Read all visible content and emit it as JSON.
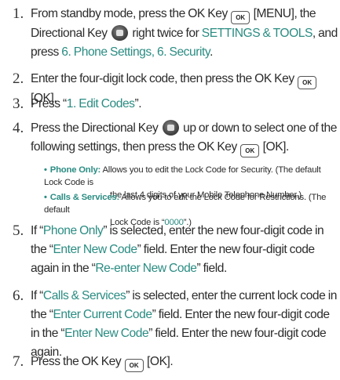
{
  "steps": [
    {
      "number": "1.",
      "t1": "From standby mode, press the OK Key",
      "t2": "[MENU], the Directional Key",
      "t3": "right twice for",
      "t4": "SETTINGS & TOOLS",
      "t5": ", and press",
      "t6": "6. Phone Settings, 6. Security",
      "t7": "."
    },
    {
      "number": "2.",
      "t1": "Enter the four-digit lock code, then press the OK Key",
      "t2": "[OK]."
    },
    {
      "number": "3.",
      "t1": "Press “",
      "t2": "1. Edit Codes",
      "t3": "”."
    },
    {
      "number": "4.",
      "t1": "Press the Directional Key",
      "t2": "up or down to select one of the following settings, then press the OK Key",
      "t3": "[OK]."
    },
    {
      "number": "5.",
      "t1": "If “",
      "t2": "Phone Only",
      "t3": "” is selected, enter the new four-digit code in the “",
      "t4": "Enter New Code",
      "t5": "” field. Enter the new four-digit code again in the “",
      "t6": "Re-enter New Code",
      "t7": "” field."
    },
    {
      "number": "6.",
      "t1": "If “",
      "t2": "Calls & Services",
      "t3": "” is selected, enter the current lock code in the “",
      "t4": "Enter Current Code",
      "t5": "” field. Enter the new four-digit code in the “",
      "t6": "Enter New Code",
      "t7": "” field. Enter the new four-digit code again."
    },
    {
      "number": "7.",
      "t1": "Press the OK Key",
      "t2": "[OK]."
    }
  ],
  "sub_items": [
    {
      "bullet": "•",
      "term": "Phone Only:",
      "line1": "Allows you to edit the Lock Code for Security. (The default Lock Code is",
      "line2": "the last 4 digits of your Mobile Telephone Number.)"
    },
    {
      "bullet": "•",
      "term": "Calls & Services:",
      "line1": "Allows you to edit the Lock Code for Restrictions. (The default",
      "line2_a": "Lock Code is “",
      "line2_b": "0000",
      "line2_c": "”.)"
    }
  ],
  "keys": {
    "ok_label": "OK",
    "ok_icon": "ok-key-icon",
    "directional_icon": "directional-key-icon"
  },
  "colors": {
    "highlight": "#2a8c82",
    "text": "#2b2b2b"
  }
}
